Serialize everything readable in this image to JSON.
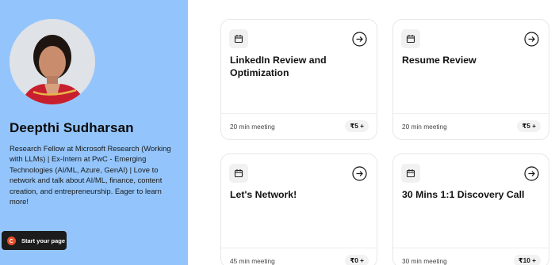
{
  "profile": {
    "name": "Deepthi Sudharsan",
    "bio": "Research Fellow at Microsoft Research (Working with LLMs) | Ex-Intern at PwC - Emerging Technologies (AI/ML, Azure, GenAI) | Love to network and talk about AI/ML, finance, content creation, and entrepreneurship. Eager to learn more!",
    "cta_label": "Start your page"
  },
  "cards": [
    {
      "title": "LinkedIn Review and Optimization",
      "duration": "20 min meeting",
      "price": "₹5 +"
    },
    {
      "title": "Resume Review",
      "duration": "20 min meeting",
      "price": "₹5 +"
    },
    {
      "title": "Let's Network!",
      "duration": "45 min meeting",
      "price": "₹0 +"
    },
    {
      "title": "30 Mins 1:1 Discovery Call",
      "duration": "30 min meeting",
      "price": "₹10 +"
    }
  ],
  "icons": {
    "card_icon": "calendar-icon",
    "card_action": "arrow-right-circle-icon",
    "cta_logo": "brand-logo"
  },
  "colors": {
    "sidebar_bg": "#93c5fc",
    "cta_bg": "#1c1c1c",
    "brand_orange": "#e8502c"
  }
}
